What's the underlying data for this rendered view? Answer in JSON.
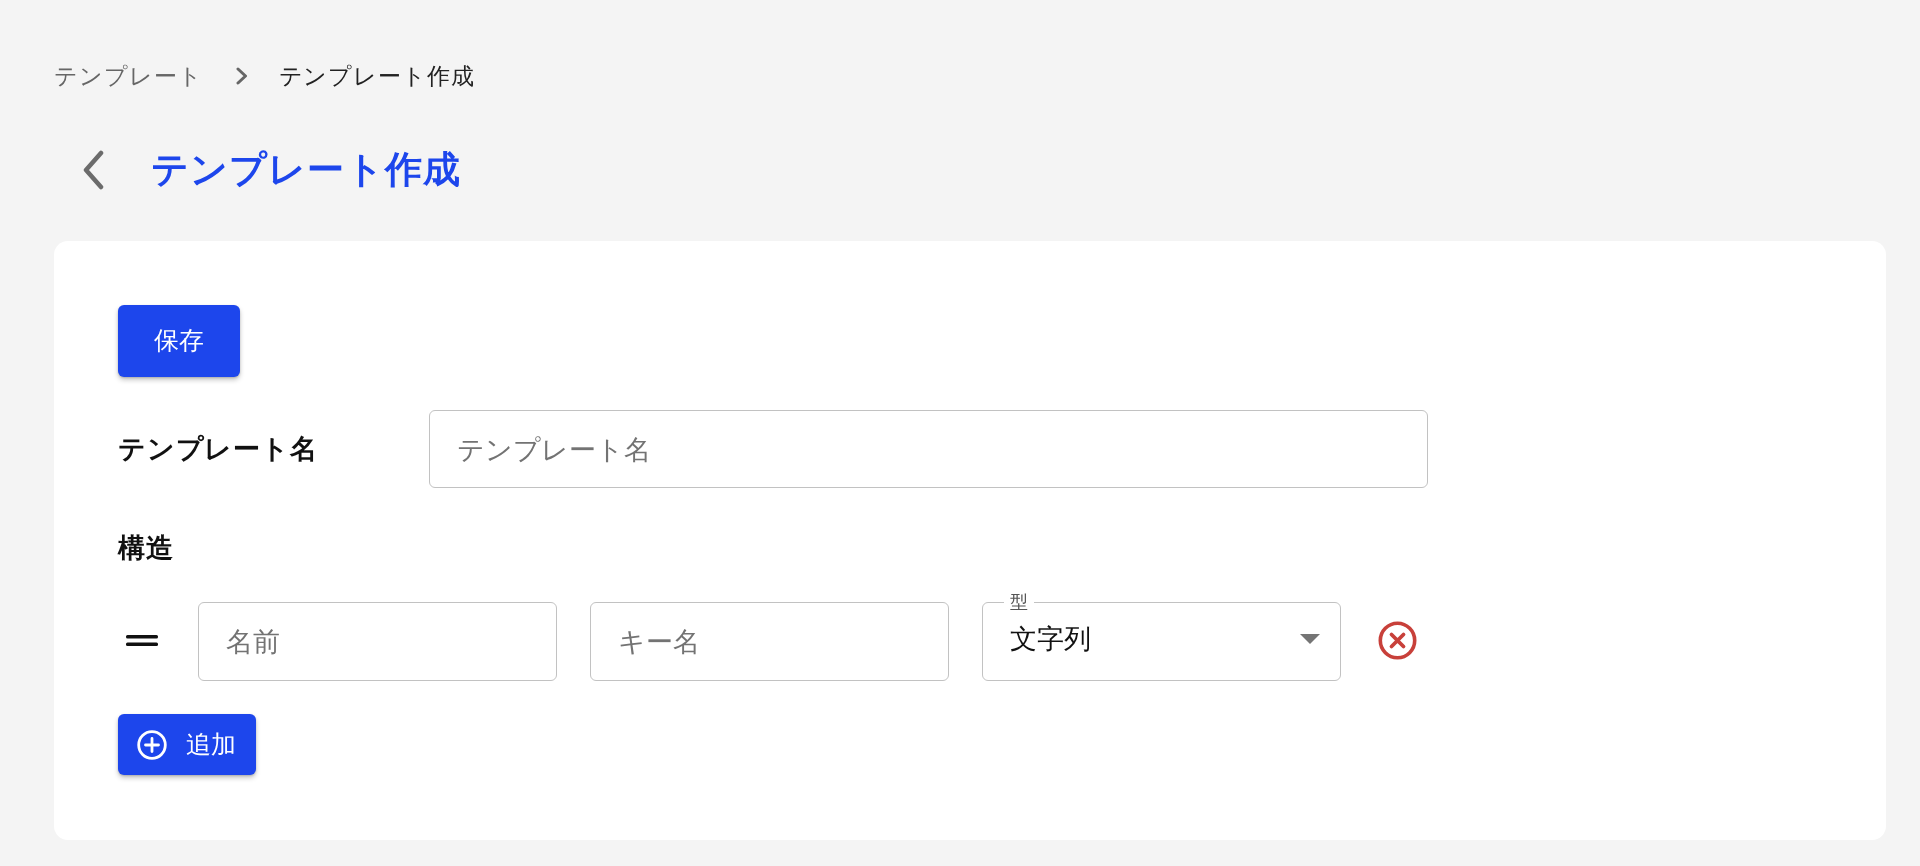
{
  "breadcrumb": [
    {
      "label": "テンプレート",
      "current": false
    },
    {
      "label": "テンプレート作成",
      "current": true
    }
  ],
  "page_title": "テンプレート作成",
  "save_button": "保存",
  "template_name": {
    "label": "テンプレート名",
    "placeholder": "テンプレート名"
  },
  "structure": {
    "label": "構造",
    "fields": [
      {
        "name_placeholder": "名前",
        "key_placeholder": "キー名",
        "type_label": "型",
        "type_value": "文字列"
      }
    ],
    "add_button": "追加"
  }
}
